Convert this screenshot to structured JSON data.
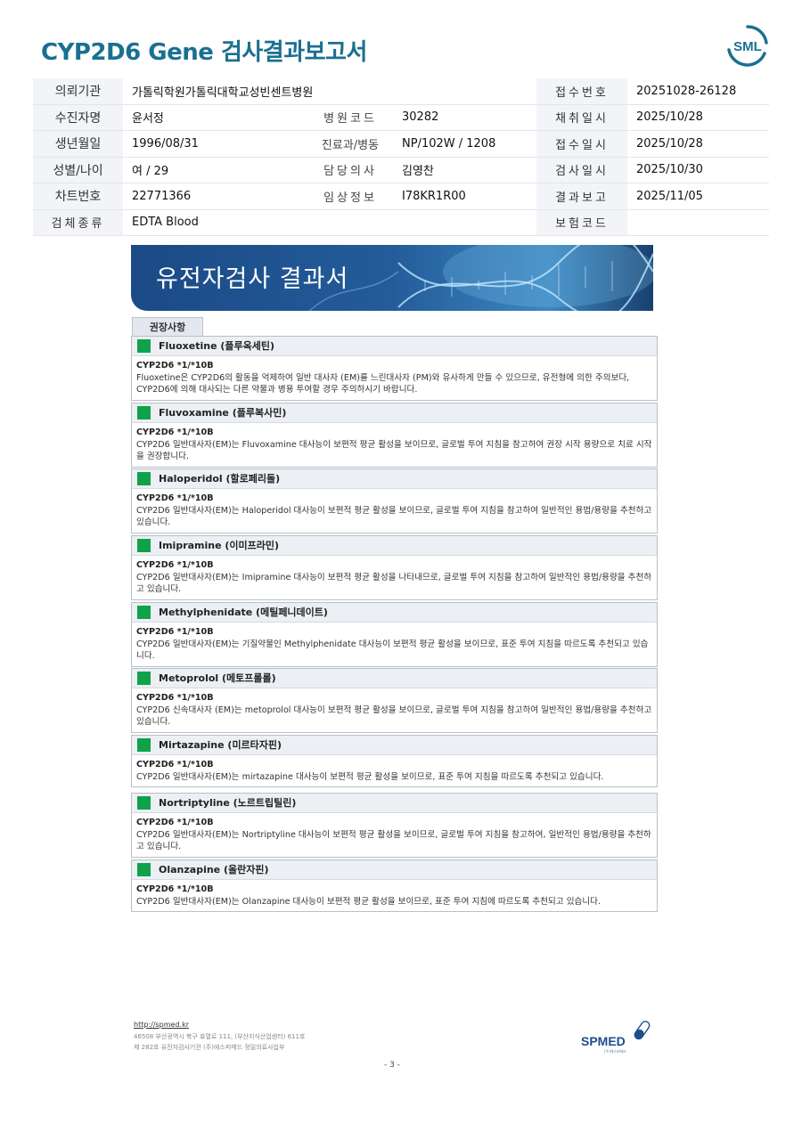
{
  "header": {
    "title": "CYP2D6 Gene 검사결과보고서",
    "logo_text": "SML"
  },
  "info": {
    "rows": [
      {
        "label": "의뢰기관",
        "value": "가톨릭학원가톨릭대학교성빈센트병원",
        "mid_label": "",
        "mid_value": "",
        "right_label": "접수번호",
        "right_value": "20251028-26128"
      },
      {
        "label": "수진자명",
        "value": "윤서정",
        "mid_label": "병원코드",
        "mid_value": "30282",
        "right_label": "채취일시",
        "right_value": "2025/10/28"
      },
      {
        "label": "생년월일",
        "value": "1996/08/31",
        "mid_label": "진료과/병동",
        "mid_value": "NP/102W / 1208",
        "right_label": "접수일시",
        "right_value": "2025/10/28"
      },
      {
        "label": "성별/나이",
        "value": "여 / 29",
        "mid_label": "담당의사",
        "mid_value": "김영찬",
        "right_label": "검사일시",
        "right_value": "2025/10/30"
      },
      {
        "label": "차트번호",
        "value": "22771366",
        "mid_label": "임상정보",
        "mid_value": "I78KR1R00",
        "right_label": "결과보고",
        "right_value": "2025/11/05"
      },
      {
        "label": "검체종류",
        "value": "EDTA Blood",
        "mid_label": "",
        "mid_value": "",
        "right_label": "보험코드",
        "right_value": ""
      }
    ]
  },
  "banner": {
    "title": "유전자검사 결과서"
  },
  "section": {
    "tab_label": "권장사항"
  },
  "recommendations": [
    {
      "drug": "Fluoxetine (플루옥세틴)",
      "genotype": "CYP2D6 *1/*10B",
      "text": "Fluoxetine은 CYP2D6의 활동을 억제하여 일반 대사자 (EM)를 느린대사자 (PM)와 유사하게 만들 수 있으므로, 유전형에 의한 주의보다, CYP2D6에 의해 대사되는 다른 약물과 병용 투여할 경우 주의하시기 바랍니다."
    },
    {
      "drug": "Fluvoxamine (플루복사민)",
      "genotype": "CYP2D6 *1/*10B",
      "text": "CYP2D6 일반대사자(EM)는 Fluvoxamine 대사능이 보편적 평균 활성을 보이므로, 글로벌 투여 지침을 참고하여 권장 시작 용량으로 치료 시작을 권장합니다."
    },
    {
      "drug": "Haloperidol (할로페리돌)",
      "genotype": "CYP2D6 *1/*10B",
      "text": "CYP2D6 일반대사자(EM)는 Haloperidol 대사능이 보편적 평균 활성을 보이므로, 글로벌 투여 지침을 참고하여 일반적인 용법/용량을 추천하고 있습니다."
    },
    {
      "drug": "Imipramine (이미프라민)",
      "genotype": "CYP2D6 *1/*10B",
      "text": "CYP2D6 일반대사자(EM)는 Imipramine 대사능이 보편적 평균 활성을 나타내므로, 글로벌 투여 지침을 참고하여 일반적인 용법/용량을 추천하고 있습니다."
    },
    {
      "drug": "Methylphenidate (메틸페니데이트)",
      "genotype": "CYP2D6 *1/*10B",
      "text": "CYP2D6 일반대사자(EM)는 기질약물인 Methylphenidate 대사능이 보편적 평균 활성을 보이므로, 표준 투여 지침을 따르도록 추천되고 있습니다."
    },
    {
      "drug": "Metoprolol (메토프롤롤)",
      "genotype": "CYP2D6 *1/*10B",
      "text": "CYP2D6 신속대사자 (EM)는 metoprolol 대사능이 보편적 평균 활성을 보이므로, 글로벌 투여 지침을 참고하여 일반적인 용법/용량을 추천하고 있습니다."
    },
    {
      "drug": "Mirtazapine (미르타자핀)",
      "genotype": "CYP2D6 *1/*10B",
      "text": "CYP2D6 일반대사자(EM)는 mirtazapine 대사능이 보편적 평균 활성을 보이므로, 표준 투여 지침을 따르도록 추천되고 있습니다."
    },
    {
      "drug": "Nortriptyline (노르트립틸린)",
      "genotype": "CYP2D6 *1/*10B",
      "text": "CYP2D6 일반대사자(EM)는 Nortriptyline 대사능이 보편적 평균 활성을 보이므로, 글로벌 투여 지침을 참고하여, 일반적인 용법/용량을 추천하고 있습니다."
    },
    {
      "drug": "Olanzapine (올란자핀)",
      "genotype": "CYP2D6 *1/*10B",
      "text": "CYP2D6 일반대사자(EM)는 Olanzapine 대사능이 보편적 평균 활성을 보이므로, 표준 투여 지침에 따르도록 추천되고 있습니다."
    }
  ],
  "footer": {
    "url": "http://spmed.kr",
    "address_line1": "46508 부산광역시 북구 효열로 111, (부산지식산업센터) 611호",
    "address_line2": "제 282호 유전자검사기관 (주)에스피메드 정밀의료사업부",
    "logo_text": "SPMED",
    "logo_sub": "(주)에스피메드",
    "page_number": "- 3 -"
  },
  "colors": {
    "title": "#1a7090",
    "marker": "#10a24b",
    "banner": "#1e4f86"
  }
}
